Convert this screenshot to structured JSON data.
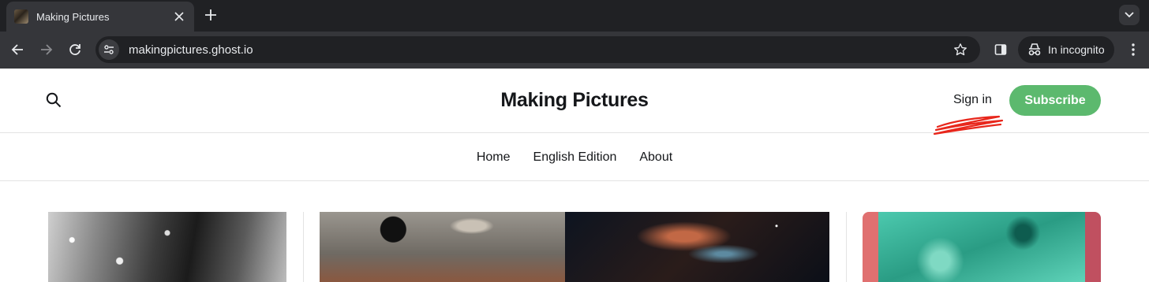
{
  "browser": {
    "tab": {
      "title": "Making Pictures",
      "favicon": "site-favicon"
    },
    "url": "makingpictures.ghost.io",
    "incognito_label": "In incognito"
  },
  "site": {
    "title": "Making Pictures",
    "signin_label": "Sign in",
    "subscribe_label": "Subscribe",
    "accent_color": "#5cb96e",
    "nav": [
      "Home",
      "English Edition",
      "About"
    ]
  },
  "annotation": {
    "color": "#e8271c",
    "shape": "red-scribble-under-sign-in"
  }
}
